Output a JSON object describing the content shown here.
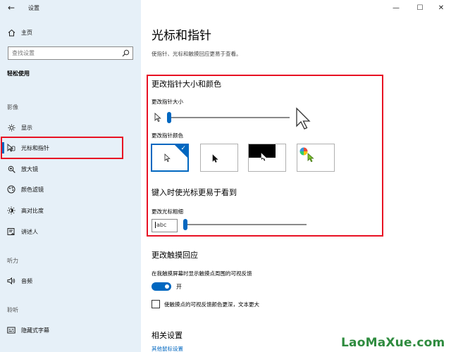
{
  "window": {
    "title": "设置",
    "back_icon": "arrow-left-icon",
    "minimize": "—",
    "maximize": "☐",
    "close": "✕"
  },
  "sidebar": {
    "home_label": "主页",
    "search_placeholder": "查找设置",
    "section_title": "轻松使用",
    "groups": [
      {
        "heading": "影像",
        "items": [
          {
            "label": "显示",
            "icon": "display-icon"
          },
          {
            "label": "光标和指针",
            "icon": "cursor-icon",
            "selected": true
          },
          {
            "label": "放大镜",
            "icon": "magnifier-icon"
          },
          {
            "label": "颜色滤镜",
            "icon": "color-filter-icon"
          },
          {
            "label": "高对比度",
            "icon": "high-contrast-icon"
          },
          {
            "label": "讲述人",
            "icon": "narrator-icon"
          }
        ]
      },
      {
        "heading": "听力",
        "items": [
          {
            "label": "音频",
            "icon": "speaker-icon"
          }
        ]
      },
      {
        "heading": "聆听",
        "items": [
          {
            "label": "隐藏式字幕",
            "icon": "captions-icon"
          }
        ]
      }
    ]
  },
  "main": {
    "title": "光标和指针",
    "description": "使指针、光标和触摸回应更易于查看。",
    "pointer_section": {
      "heading": "更改指针大小和颜色",
      "size_label": "更改指针大小",
      "size_value": 0.0,
      "color_label": "更改指针颜色",
      "color_options": [
        "white",
        "black",
        "inverted",
        "custom"
      ],
      "selected_color": "white"
    },
    "cursor_section": {
      "heading": "键入时使光标更易于看到",
      "thickness_label": "更改光标粗细",
      "preview_text": "abc",
      "thickness_value": 0.0
    },
    "touch_section": {
      "heading": "更改触摸回应",
      "feedback_label": "在我触摸屏幕时显示触摸点周围的可视反馈",
      "toggle_state": "开",
      "toggle_on": true,
      "darker_label": "使触摸点的可视反馈颜色更深，文本更大",
      "darker_checked": false
    },
    "related": {
      "heading": "相关设置",
      "link": "其他鼠标设置"
    }
  },
  "watermark": "LaoMaXue.com",
  "colors": {
    "accent": "#0067c0",
    "highlight_frame": "#e81123",
    "sidebar_bg": "#e6f0f8",
    "watermark": "#2e8b3e"
  }
}
